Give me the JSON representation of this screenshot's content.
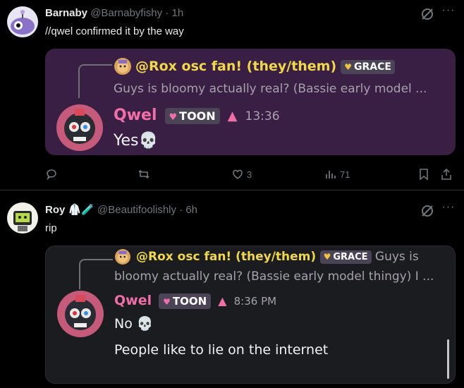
{
  "post1": {
    "name": "Barnaby",
    "handle": "@Barnabyfishy",
    "time": "· 1h",
    "text": "//qwel confirmed it by the way",
    "embed": {
      "ref_name": "@Rox osc fan! (they/them)",
      "ref_tag": "GRACE",
      "ref_text": "Guys is bloomy actually real? (Bassie early model ...",
      "author": "Qwel",
      "author_tag": "TOON",
      "time": "13:36",
      "message": "Yes💀"
    },
    "actions": {
      "likes": "3",
      "views": "71"
    }
  },
  "post2": {
    "name": "Roy",
    "emoji": "🥼🧪",
    "handle": "@Beautifoolishly",
    "time": "· 6h",
    "text": "rip",
    "embed": {
      "ref_name": "@Rox osc fan! (they/them)",
      "ref_tag": "GRACE",
      "ref_text_line1": "Guys is",
      "ref_text_line2": "bloomy actually real? (Bassie early model thingy) I ...",
      "author": "Qwel",
      "author_tag": "TOON",
      "time": "8:36 PM",
      "message1": "No 💀",
      "message2": "People like to lie on the internet"
    }
  },
  "colors": {
    "embed1_bg": "#3a1f45",
    "embed2_bg": "#1b1c20",
    "author": "#f06fa8",
    "ref_name": "#f0d84a"
  }
}
